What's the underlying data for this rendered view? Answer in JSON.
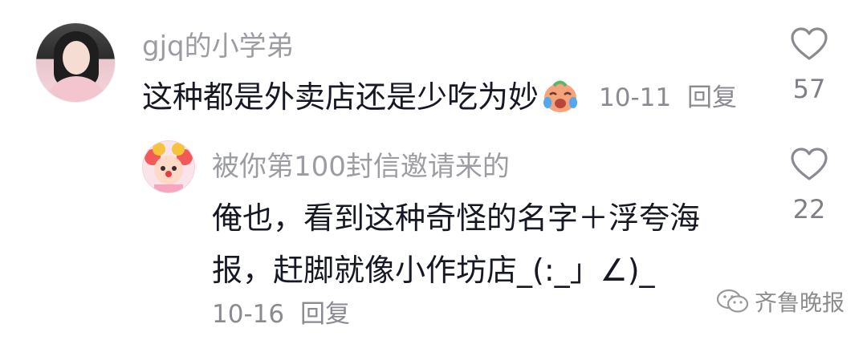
{
  "comment": {
    "username": "gjq的小学弟",
    "text": "这种都是外卖店还是少吃为妙",
    "emoji_icon": "crying-laughing-emoji-icon",
    "date": "10-11",
    "reply_label": "回复",
    "likes": "57"
  },
  "reply": {
    "username": "被你第100封信邀请来的",
    "text_line1": "俺也，看到这种奇怪的名字＋浮夸海",
    "text_line2": "报，赶脚就像小作坊店_(:_」∠)_",
    "date": "10-16",
    "reply_label": "回复",
    "likes": "22"
  },
  "watermark": {
    "text": "齐鲁晚报",
    "icon": "wechat-icon"
  }
}
